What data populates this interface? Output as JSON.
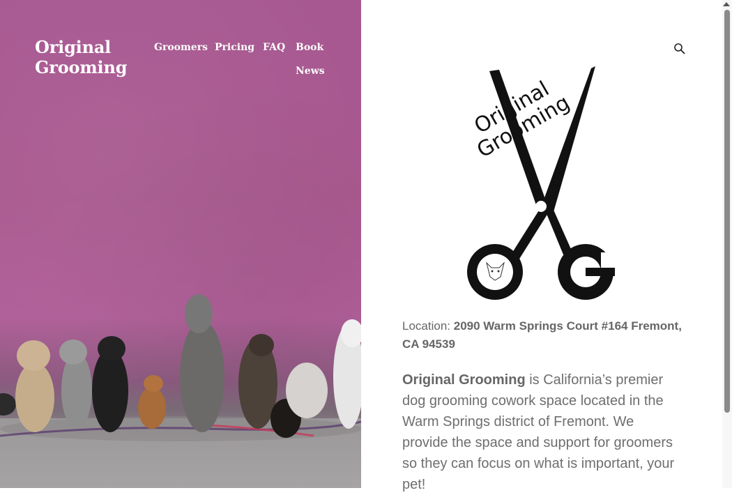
{
  "site": {
    "title": "Original Grooming"
  },
  "nav": {
    "items": [
      {
        "label": "Groomers"
      },
      {
        "label": "Pricing"
      },
      {
        "label": "FAQ"
      },
      {
        "label": "Book"
      },
      {
        "label": "News"
      }
    ]
  },
  "logo": {
    "line1": "Original",
    "line2": "Grooming",
    "initial_left": "O",
    "initial_right": "G"
  },
  "location": {
    "label": "Location: ",
    "address": "2090 Warm Springs Court #164 Fremont, CA 94539"
  },
  "intro": {
    "brand": "Original Grooming",
    "text": " is California’s premier dog grooming cowork space located in the Warm Springs district of Fremont. We provide the space and support for groomers so they can focus on what is important, your pet!"
  },
  "icons": {
    "search": "search-icon"
  },
  "colors": {
    "hero_background": "#a75891",
    "text_gray": "#666666"
  }
}
